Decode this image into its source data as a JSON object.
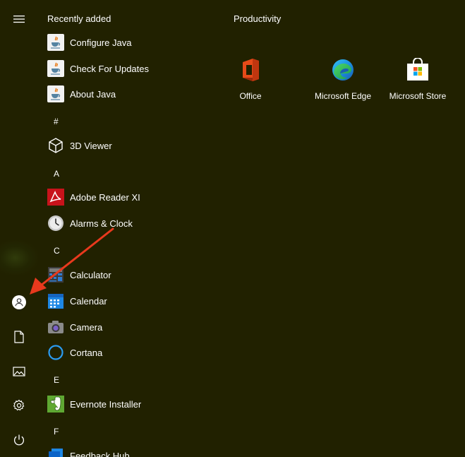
{
  "app_list": {
    "recently_added_title": "Recently added",
    "recent": [
      {
        "label": "Configure Java",
        "icon": "java-icon"
      },
      {
        "label": "Check For Updates",
        "icon": "java-icon"
      },
      {
        "label": "About Java",
        "icon": "java-icon"
      }
    ],
    "groups": [
      {
        "letter": "#",
        "items": [
          {
            "label": "3D Viewer",
            "icon": "cube-icon"
          }
        ]
      },
      {
        "letter": "A",
        "items": [
          {
            "label": "Adobe Reader XI",
            "icon": "adobe-reader-icon"
          },
          {
            "label": "Alarms & Clock",
            "icon": "clock-icon"
          }
        ]
      },
      {
        "letter": "C",
        "items": [
          {
            "label": "Calculator",
            "icon": "calculator-icon"
          },
          {
            "label": "Calendar",
            "icon": "calendar-icon"
          },
          {
            "label": "Camera",
            "icon": "camera-icon"
          },
          {
            "label": "Cortana",
            "icon": "cortana-icon"
          }
        ]
      },
      {
        "letter": "E",
        "items": [
          {
            "label": "Evernote Installer",
            "icon": "evernote-icon"
          }
        ]
      },
      {
        "letter": "F",
        "items": [
          {
            "label": "Feedback Hub",
            "icon": "feedback-hub-icon"
          }
        ]
      }
    ]
  },
  "productivity": {
    "title": "Productivity",
    "tiles": [
      {
        "label": "Office",
        "icon": "office-icon"
      },
      {
        "label": "Microsoft Edge",
        "icon": "edge-icon"
      },
      {
        "label": "Microsoft Store",
        "icon": "store-icon"
      }
    ]
  },
  "rail": {
    "icons": [
      "hamburger-menu-icon",
      "user-account-icon",
      "documents-icon",
      "pictures-icon",
      "settings-gear-icon",
      "power-icon"
    ]
  },
  "colors": {
    "background": "#212100",
    "annotation_arrow": "#e8391d",
    "accent_blue": "#1e90ff"
  }
}
